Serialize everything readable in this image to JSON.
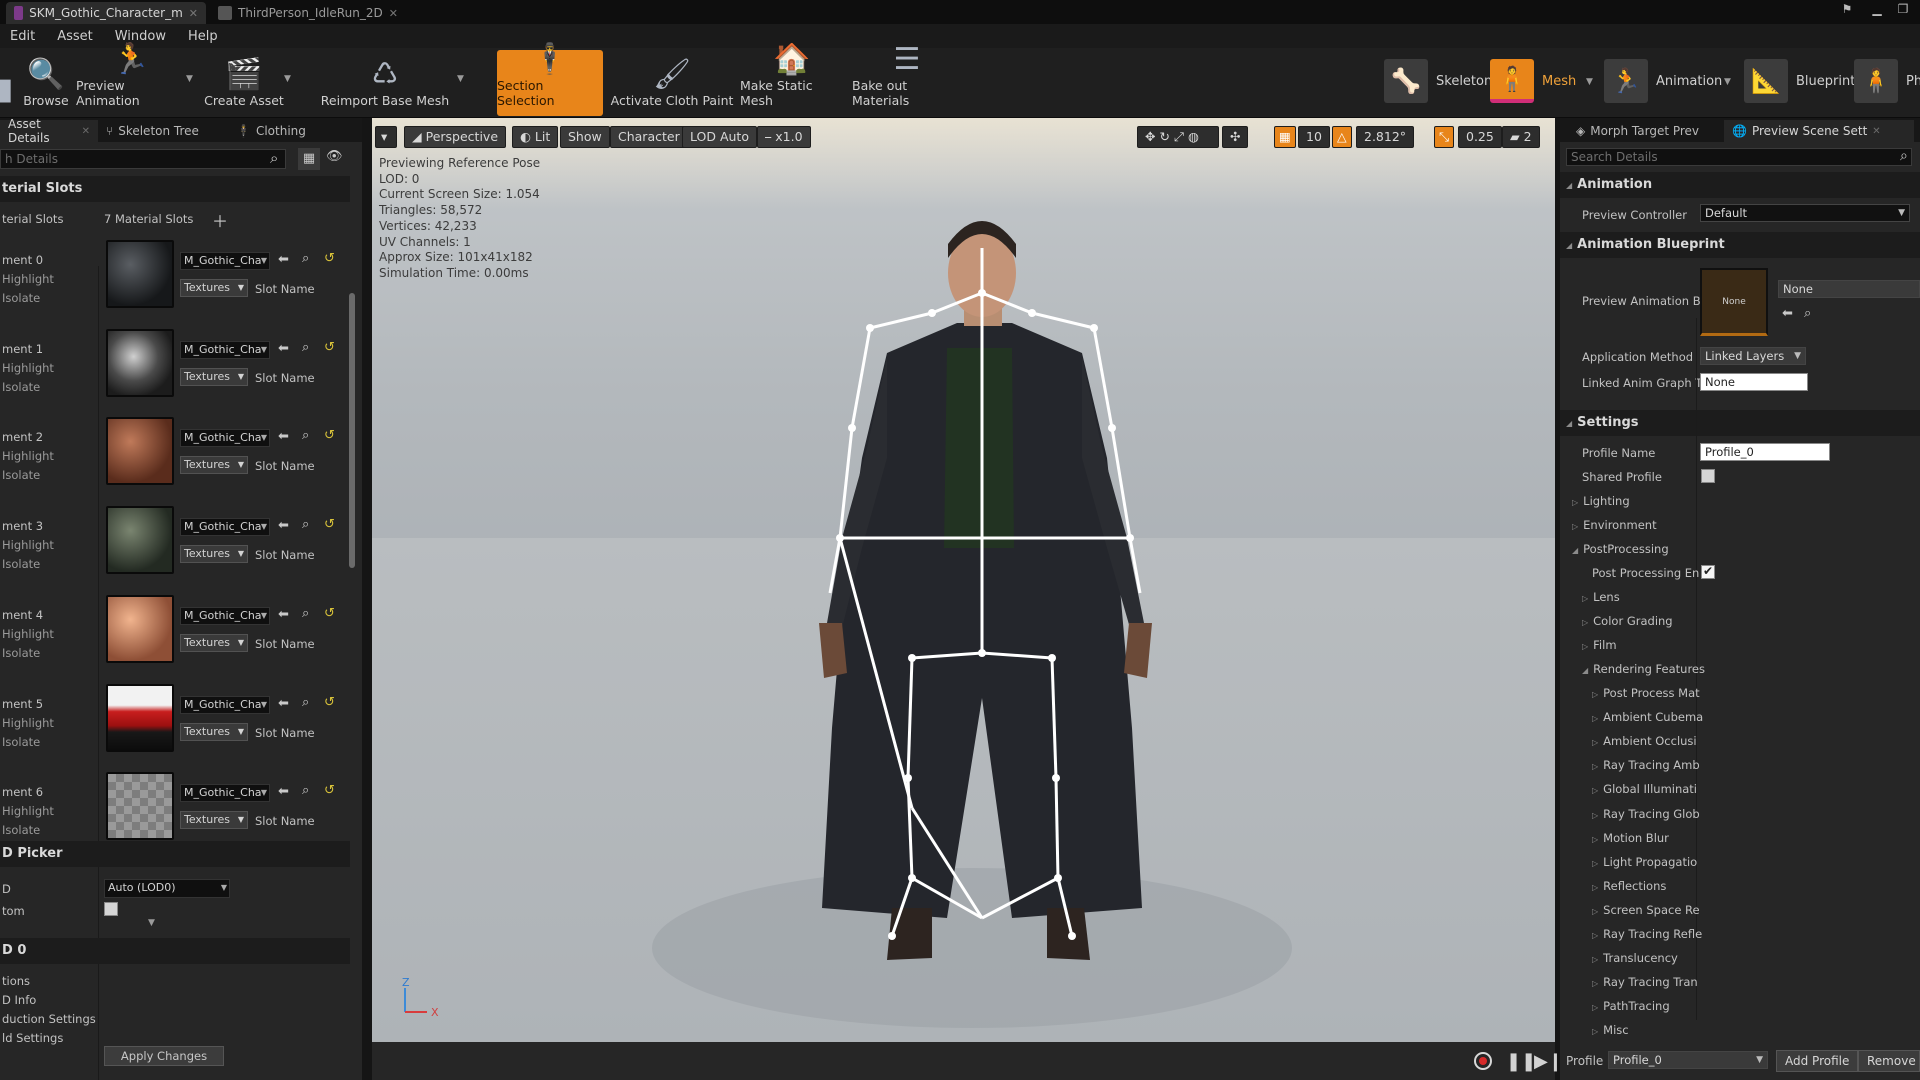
{
  "tabs": [
    {
      "label": "SKM_Gothic_Character_m",
      "active": true
    },
    {
      "label": "ThirdPerson_IdleRun_2D",
      "active": false
    }
  ],
  "menu": [
    "Edit",
    "Asset",
    "Window",
    "Help"
  ],
  "toolbar": {
    "browse": "Browse",
    "preview_animation": "Preview Animation",
    "create_asset": "Create Asset",
    "reimport": "Reimport Base Mesh",
    "section_selection": "Section Selection",
    "activate_cloth": "Activate Cloth Paint",
    "make_static": "Make Static Mesh",
    "bake_materials": "Bake out Materials"
  },
  "modes": {
    "skeleton": "Skeleton",
    "mesh": "Mesh",
    "animation": "Animation",
    "blueprint": "Blueprint",
    "physics": "Ph"
  },
  "left_panel": {
    "tabs": [
      "Asset Details",
      "Skeleton Tree",
      "Clothing"
    ],
    "search_placeholder": "h Details",
    "material_slots_header": "terial Slots",
    "slots_label": "terial Slots",
    "slots_count": "7 Material Slots",
    "elements": [
      {
        "name": "ment 0",
        "material": "M_Gothic_Cha",
        "textures": "Textures",
        "slot_name": "Slot Name"
      },
      {
        "name": "ment 1",
        "material": "M_Gothic_Cha",
        "textures": "Textures",
        "slot_name": "Slot Name"
      },
      {
        "name": "ment 2",
        "material": "M_Gothic_Cha",
        "textures": "Textures",
        "slot_name": "Slot Name"
      },
      {
        "name": "ment 3",
        "material": "M_Gothic_Cha",
        "textures": "Textures",
        "slot_name": "Slot Name"
      },
      {
        "name": "ment 4",
        "material": "M_Gothic_Cha",
        "textures": "Textures",
        "slot_name": "Slot Name"
      },
      {
        "name": "ment 5",
        "material": "M_Gothic_Cha",
        "textures": "Textures",
        "slot_name": "Slot Name"
      },
      {
        "name": "ment 6",
        "material": "M_Gothic_Cha",
        "textures": "Textures",
        "slot_name": "Slot Name"
      }
    ],
    "highlight": "Highlight",
    "isolate": "Isolate",
    "lod_picker_header": "D Picker",
    "lod_row_label": "D",
    "lod_value": "Auto (LOD0)",
    "custom_label": "tom",
    "lod0_header": "D 0",
    "lod0_items": [
      "tions",
      "D Info",
      "duction Settings",
      "ld Settings"
    ],
    "apply_changes": "Apply Changes"
  },
  "viewport": {
    "perspective": "Perspective",
    "lit": "Lit",
    "show": "Show",
    "character": "Character",
    "lod": "LOD Auto",
    "speed": "x1.0",
    "grid_value": "10",
    "rotation_value": "2.812°",
    "scale_value": "0.25",
    "camera_speed": "2",
    "info_lines": [
      "Previewing Reference Pose",
      "LOD: 0",
      "Current Screen Size: 1.054",
      "Triangles: 58,572",
      "Vertices: 42,233",
      "UV Channels: 1",
      "Approx Size: 101x41x182",
      "Simulation Time: 0.00ms"
    ],
    "axis_z": "Z",
    "axis_x": "X"
  },
  "right_panel": {
    "tabs": [
      "Morph Target Prev",
      "Preview Scene Sett"
    ],
    "search_placeholder": "Search Details",
    "animation_header": "Animation",
    "preview_controller_label": "Preview Controller",
    "preview_controller_value": "Default",
    "anim_bp_header": "Animation Blueprint",
    "preview_anim_bp_label": "Preview Animation Bl",
    "anim_bp_thumb": "None",
    "anim_bp_value": "None",
    "application_method_label": "Application Method",
    "application_method_value": "Linked Layers",
    "linked_anim_label": "Linked Anim Graph Ta",
    "linked_anim_value": "None",
    "settings_header": "Settings",
    "profile_name_label": "Profile Name",
    "profile_name_value": "Profile_0",
    "shared_profile_label": "Shared Profile",
    "lighting": "Lighting",
    "environment": "Environment",
    "postprocessing": "PostProcessing",
    "pp_enabled_label": "Post Processing En",
    "lens": "Lens",
    "color_grading": "Color Grading",
    "film": "Film",
    "rendering_features": "Rendering Features",
    "rendering_items": [
      "Post Process Mat",
      "Ambient Cubema",
      "Ambient Occlusi",
      "Ray Tracing Amb",
      "Global Illuminati",
      "Ray Tracing Glob",
      "Motion Blur",
      "Light Propagatio",
      "Reflections",
      "Screen Space Re",
      "Ray Tracing Refle",
      "Translucency",
      "Ray Tracing Tran",
      "PathTracing",
      "Misc"
    ],
    "profile_label": "Profile",
    "profile_value": "Profile_0",
    "add_profile": "Add Profile",
    "remove_profile": "Remove P"
  },
  "colors": {
    "accent_orange": "#e8851a",
    "mesh_underline": "#d02e78",
    "panel_bg": "#262626"
  }
}
